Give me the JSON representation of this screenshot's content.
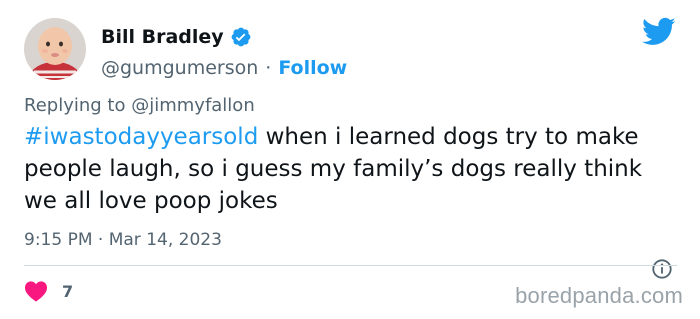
{
  "author": {
    "display_name": "Bill Bradley",
    "handle": "@gumgumerson",
    "separator": "·",
    "follow_label": "Follow",
    "verified_icon": "verified-badge-icon"
  },
  "reply_context": {
    "prefix": "Replying to",
    "mention": "@jimmyfallon"
  },
  "tweet": {
    "hashtag": "#iwastodayyearsold",
    "body": " when i learned dogs try to make people laugh, so i guess my family’s dogs really think we all love poop jokes"
  },
  "meta": {
    "time": "9:15 PM",
    "separator": "·",
    "date": "Mar 14, 2023"
  },
  "engagement": {
    "likes": "7",
    "like_icon": "heart-icon"
  },
  "watermark": "boredpanda.com",
  "colors": {
    "accent": "#1d9bf0",
    "text_primary": "#0f1419",
    "text_secondary": "#536471",
    "heart": "#f91880",
    "divider": "#cfd9de"
  },
  "icons": {
    "brand": "twitter-bird-icon",
    "info": "info-icon"
  }
}
